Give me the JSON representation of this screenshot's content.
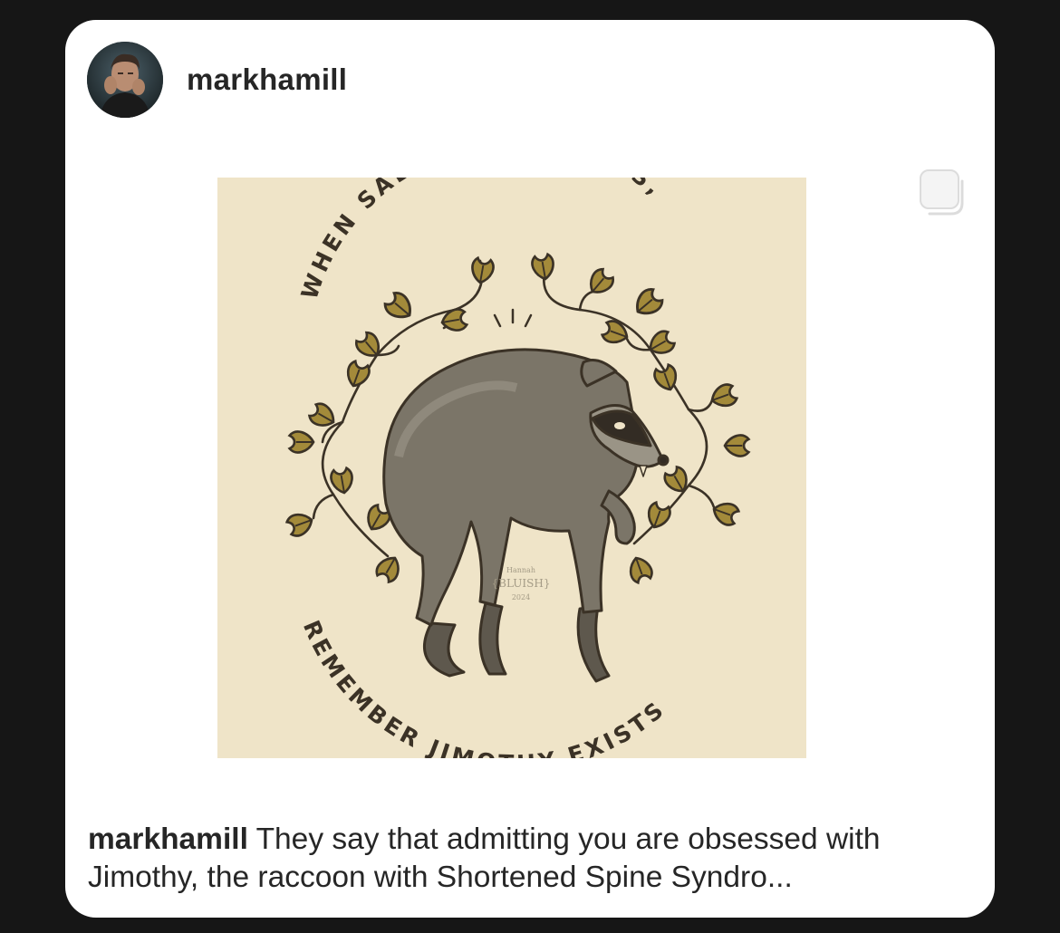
{
  "post": {
    "username": "markhamill",
    "image": {
      "top_text": "WHEN SADNESS PERSISTS,",
      "bottom_text": "REMEMBER JIMOTHY EXISTS",
      "signature_line1": "Hannah",
      "signature_line2": "{BLUISH}",
      "signature_line3": "2024"
    },
    "caption_username": "markhamill",
    "caption_text": " They say that admitting you are obsessed with Jimothy, the raccoon with Shortened Spine Syndro..."
  },
  "colors": {
    "background": "#161616",
    "card": "#ffffff",
    "art_background": "#efe4c8",
    "leaf": "#a38a3a",
    "ink": "#3b3226",
    "raccoon": "#7b7568"
  }
}
